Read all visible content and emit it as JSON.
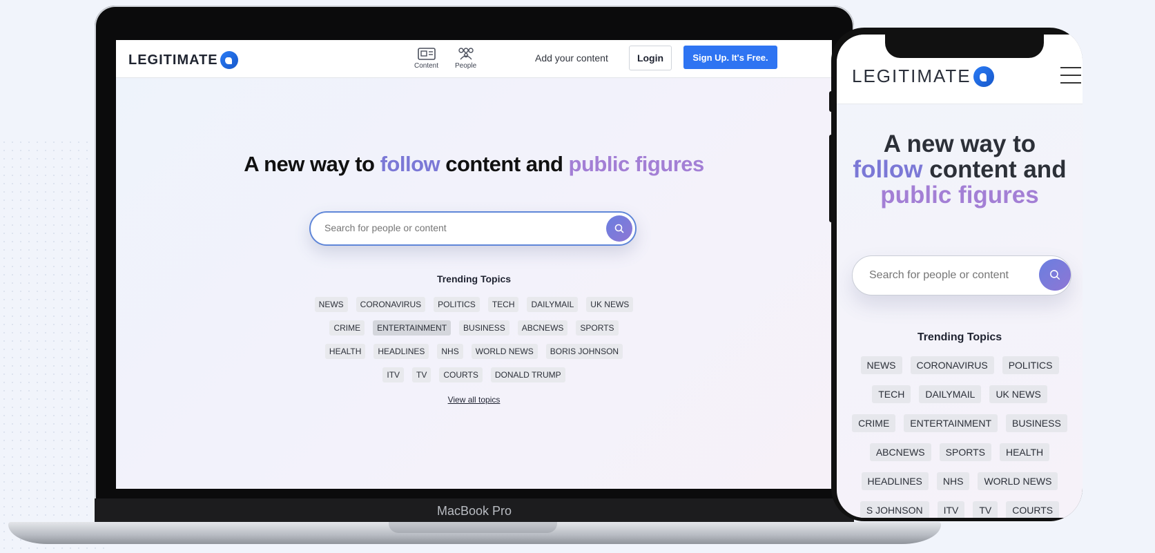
{
  "brand": {
    "name": "LEGITIMATE"
  },
  "device": {
    "laptop_label": "MacBook Pro"
  },
  "nav": {
    "content_label": "Content",
    "people_label": "People",
    "add_content": "Add your content",
    "login": "Login",
    "signup": "Sign Up. It's Free."
  },
  "hero": {
    "part1": "A new way to ",
    "highlight1": "follow",
    "part2": " content and ",
    "highlight2": "public figures"
  },
  "search": {
    "placeholder": "Search for people or content"
  },
  "trending": {
    "title": "Trending Topics",
    "laptop_rows": [
      [
        "NEWS",
        "CORONAVIRUS",
        "POLITICS",
        "TECH",
        "DAILYMAIL",
        "UK NEWS"
      ],
      [
        "CRIME",
        "ENTERTAINMENT",
        "BUSINESS",
        "ABCNEWS",
        "SPORTS"
      ],
      [
        "HEALTH",
        "HEADLINES",
        "NHS",
        "WORLD NEWS",
        "BORIS JOHNSON"
      ],
      [
        "ITV",
        "TV",
        "COURTS",
        "DONALD TRUMP"
      ]
    ],
    "phone_rows": [
      [
        "NEWS",
        "CORONAVIRUS",
        "POLITICS"
      ],
      [
        "TECH",
        "DAILYMAIL",
        "UK NEWS"
      ],
      [
        "CRIME",
        "ENTERTAINMENT",
        "BUSINESS"
      ],
      [
        "ABCNEWS",
        "SPORTS",
        "HEALTH"
      ],
      [
        "HEADLINES",
        "NHS",
        "WORLD NEWS"
      ],
      [
        "S JOHNSON",
        "ITV",
        "TV",
        "COURTS"
      ]
    ],
    "view_all": "View all topics"
  },
  "colors": {
    "primary": "#2e74f2",
    "highlight_follow": "#7b78d6",
    "highlight_figures": "#a37fd5",
    "search_button": "#7a7adb"
  },
  "icons": {
    "content": "newspaper-icon",
    "people": "people-icon",
    "search": "search-icon",
    "menu": "hamburger-icon"
  }
}
